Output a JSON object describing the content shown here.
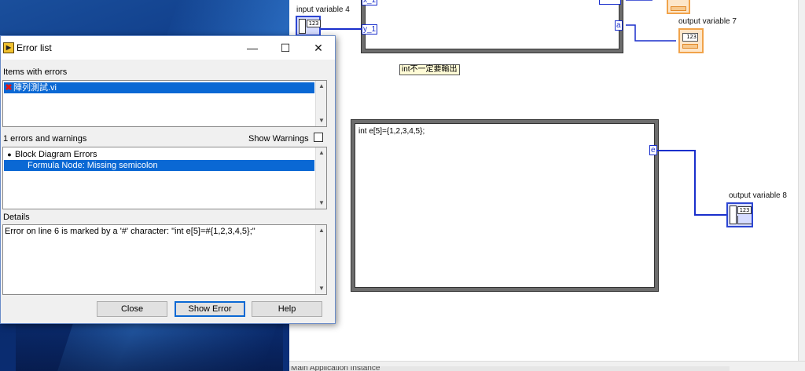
{
  "diagram": {
    "input_label": "input variable 4",
    "output7_label": "output variable 7",
    "output8_label": "output variable 8",
    "tunnel_y1": "y_1",
    "tunnel_x1": "x_1",
    "tunnel_a": "a",
    "tunnel_e": "e",
    "comment": "int不一定要輸出",
    "formula_code": "int e[5]={1,2,3,4,5};",
    "num_glyph": "123",
    "status_text": "Main Application Instance"
  },
  "dialog": {
    "title": "Error list",
    "minimize": "—",
    "maximize": "☐",
    "close_x": "✕",
    "items_label": "Items with errors",
    "items": [
      {
        "name": "陣列測試.vi"
      }
    ],
    "errors_count_label": "1 errors and warnings",
    "show_warnings_label": "Show Warnings",
    "show_warnings_checked": false,
    "error_groups": [
      {
        "label": "Block Diagram Errors",
        "selected": false
      },
      {
        "label": "Formula Node: Missing semicolon",
        "selected": true
      }
    ],
    "details_label": "Details",
    "details_text": "Error on line 6 is marked by a '#' character: \"int e[5]=#{1,2,3,4,5};\"",
    "buttons": {
      "close": "Close",
      "show_error": "Show Error",
      "help": "Help"
    }
  },
  "colors": {
    "wire_blue": "#1a2fcc",
    "selection": "#0a68d4",
    "error_x": "#e41414"
  }
}
